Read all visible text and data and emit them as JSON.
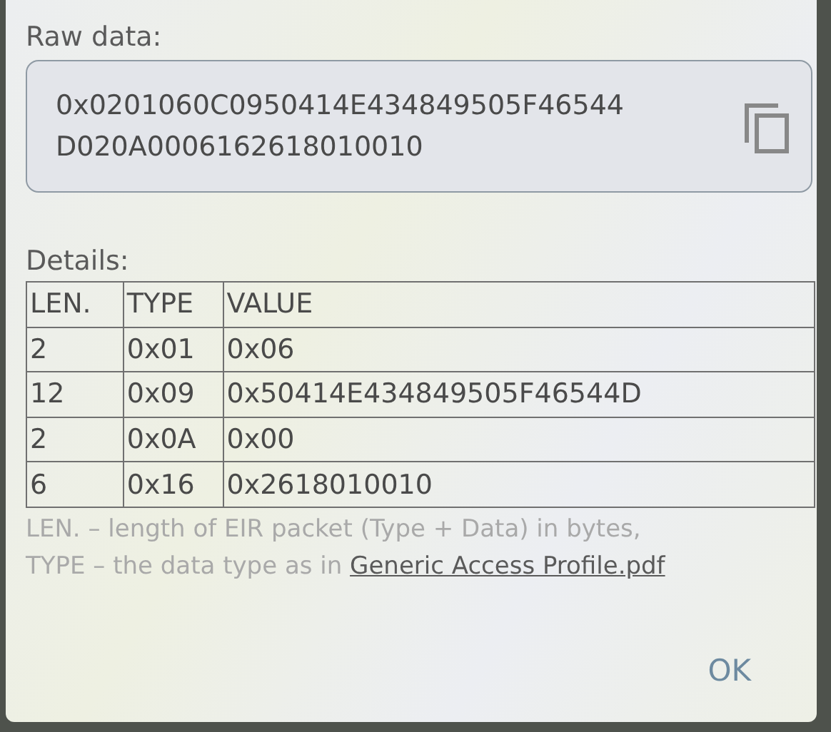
{
  "raw_data": {
    "label": "Raw data:",
    "value_lines": [
      "0x0201060C0950414E434849505F46544",
      "D020A0006162618010010"
    ]
  },
  "details": {
    "label": "Details:",
    "columns": [
      "LEN.",
      "TYPE",
      "VALUE"
    ],
    "rows": [
      [
        "2",
        "0x01",
        "0x06"
      ],
      [
        "12",
        "0x09",
        "0x50414E434849505F46544D"
      ],
      [
        "2",
        "0x0A",
        "0x00"
      ],
      [
        "6",
        "0x16",
        "0x2618010010"
      ]
    ],
    "note_lines": [
      "LEN. – length of EIR packet (Type + Data) in bytes,",
      "TYPE – the data type as in"
    ],
    "note_link": "Generic Access Profile.pdf"
  },
  "buttons": [
    "OK"
  ]
}
